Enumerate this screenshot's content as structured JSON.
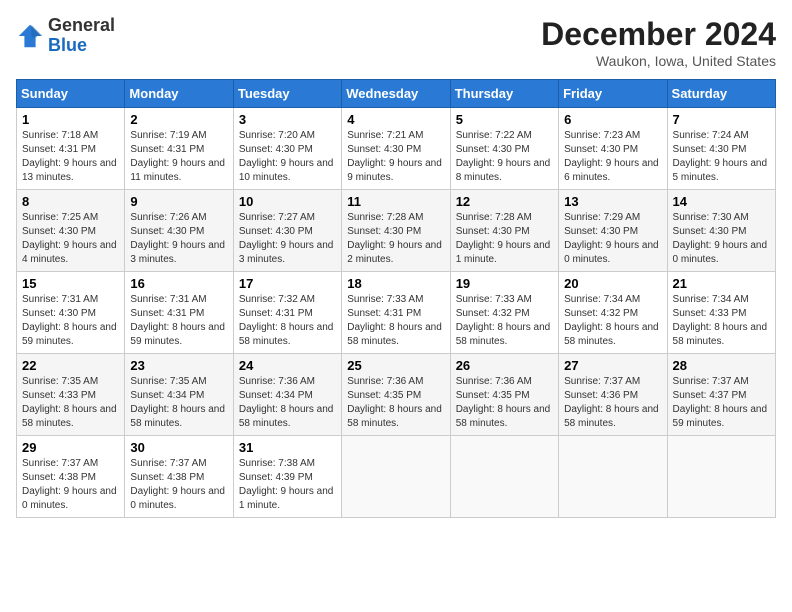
{
  "header": {
    "logo_general": "General",
    "logo_blue": "Blue",
    "month_title": "December 2024",
    "location": "Waukon, Iowa, United States"
  },
  "days_of_week": [
    "Sunday",
    "Monday",
    "Tuesday",
    "Wednesday",
    "Thursday",
    "Friday",
    "Saturday"
  ],
  "weeks": [
    [
      {
        "day": "1",
        "sunrise": "7:18 AM",
        "sunset": "4:31 PM",
        "daylight": "9 hours and 13 minutes."
      },
      {
        "day": "2",
        "sunrise": "7:19 AM",
        "sunset": "4:31 PM",
        "daylight": "9 hours and 11 minutes."
      },
      {
        "day": "3",
        "sunrise": "7:20 AM",
        "sunset": "4:30 PM",
        "daylight": "9 hours and 10 minutes."
      },
      {
        "day": "4",
        "sunrise": "7:21 AM",
        "sunset": "4:30 PM",
        "daylight": "9 hours and 9 minutes."
      },
      {
        "day": "5",
        "sunrise": "7:22 AM",
        "sunset": "4:30 PM",
        "daylight": "9 hours and 8 minutes."
      },
      {
        "day": "6",
        "sunrise": "7:23 AM",
        "sunset": "4:30 PM",
        "daylight": "9 hours and 6 minutes."
      },
      {
        "day": "7",
        "sunrise": "7:24 AM",
        "sunset": "4:30 PM",
        "daylight": "9 hours and 5 minutes."
      }
    ],
    [
      {
        "day": "8",
        "sunrise": "7:25 AM",
        "sunset": "4:30 PM",
        "daylight": "9 hours and 4 minutes."
      },
      {
        "day": "9",
        "sunrise": "7:26 AM",
        "sunset": "4:30 PM",
        "daylight": "9 hours and 3 minutes."
      },
      {
        "day": "10",
        "sunrise": "7:27 AM",
        "sunset": "4:30 PM",
        "daylight": "9 hours and 3 minutes."
      },
      {
        "day": "11",
        "sunrise": "7:28 AM",
        "sunset": "4:30 PM",
        "daylight": "9 hours and 2 minutes."
      },
      {
        "day": "12",
        "sunrise": "7:28 AM",
        "sunset": "4:30 PM",
        "daylight": "9 hours and 1 minute."
      },
      {
        "day": "13",
        "sunrise": "7:29 AM",
        "sunset": "4:30 PM",
        "daylight": "9 hours and 0 minutes."
      },
      {
        "day": "14",
        "sunrise": "7:30 AM",
        "sunset": "4:30 PM",
        "daylight": "9 hours and 0 minutes."
      }
    ],
    [
      {
        "day": "15",
        "sunrise": "7:31 AM",
        "sunset": "4:30 PM",
        "daylight": "8 hours and 59 minutes."
      },
      {
        "day": "16",
        "sunrise": "7:31 AM",
        "sunset": "4:31 PM",
        "daylight": "8 hours and 59 minutes."
      },
      {
        "day": "17",
        "sunrise": "7:32 AM",
        "sunset": "4:31 PM",
        "daylight": "8 hours and 58 minutes."
      },
      {
        "day": "18",
        "sunrise": "7:33 AM",
        "sunset": "4:31 PM",
        "daylight": "8 hours and 58 minutes."
      },
      {
        "day": "19",
        "sunrise": "7:33 AM",
        "sunset": "4:32 PM",
        "daylight": "8 hours and 58 minutes."
      },
      {
        "day": "20",
        "sunrise": "7:34 AM",
        "sunset": "4:32 PM",
        "daylight": "8 hours and 58 minutes."
      },
      {
        "day": "21",
        "sunrise": "7:34 AM",
        "sunset": "4:33 PM",
        "daylight": "8 hours and 58 minutes."
      }
    ],
    [
      {
        "day": "22",
        "sunrise": "7:35 AM",
        "sunset": "4:33 PM",
        "daylight": "8 hours and 58 minutes."
      },
      {
        "day": "23",
        "sunrise": "7:35 AM",
        "sunset": "4:34 PM",
        "daylight": "8 hours and 58 minutes."
      },
      {
        "day": "24",
        "sunrise": "7:36 AM",
        "sunset": "4:34 PM",
        "daylight": "8 hours and 58 minutes."
      },
      {
        "day": "25",
        "sunrise": "7:36 AM",
        "sunset": "4:35 PM",
        "daylight": "8 hours and 58 minutes."
      },
      {
        "day": "26",
        "sunrise": "7:36 AM",
        "sunset": "4:35 PM",
        "daylight": "8 hours and 58 minutes."
      },
      {
        "day": "27",
        "sunrise": "7:37 AM",
        "sunset": "4:36 PM",
        "daylight": "8 hours and 58 minutes."
      },
      {
        "day": "28",
        "sunrise": "7:37 AM",
        "sunset": "4:37 PM",
        "daylight": "8 hours and 59 minutes."
      }
    ],
    [
      {
        "day": "29",
        "sunrise": "7:37 AM",
        "sunset": "4:38 PM",
        "daylight": "9 hours and 0 minutes."
      },
      {
        "day": "30",
        "sunrise": "7:37 AM",
        "sunset": "4:38 PM",
        "daylight": "9 hours and 0 minutes."
      },
      {
        "day": "31",
        "sunrise": "7:38 AM",
        "sunset": "4:39 PM",
        "daylight": "9 hours and 1 minute."
      },
      null,
      null,
      null,
      null
    ]
  ]
}
